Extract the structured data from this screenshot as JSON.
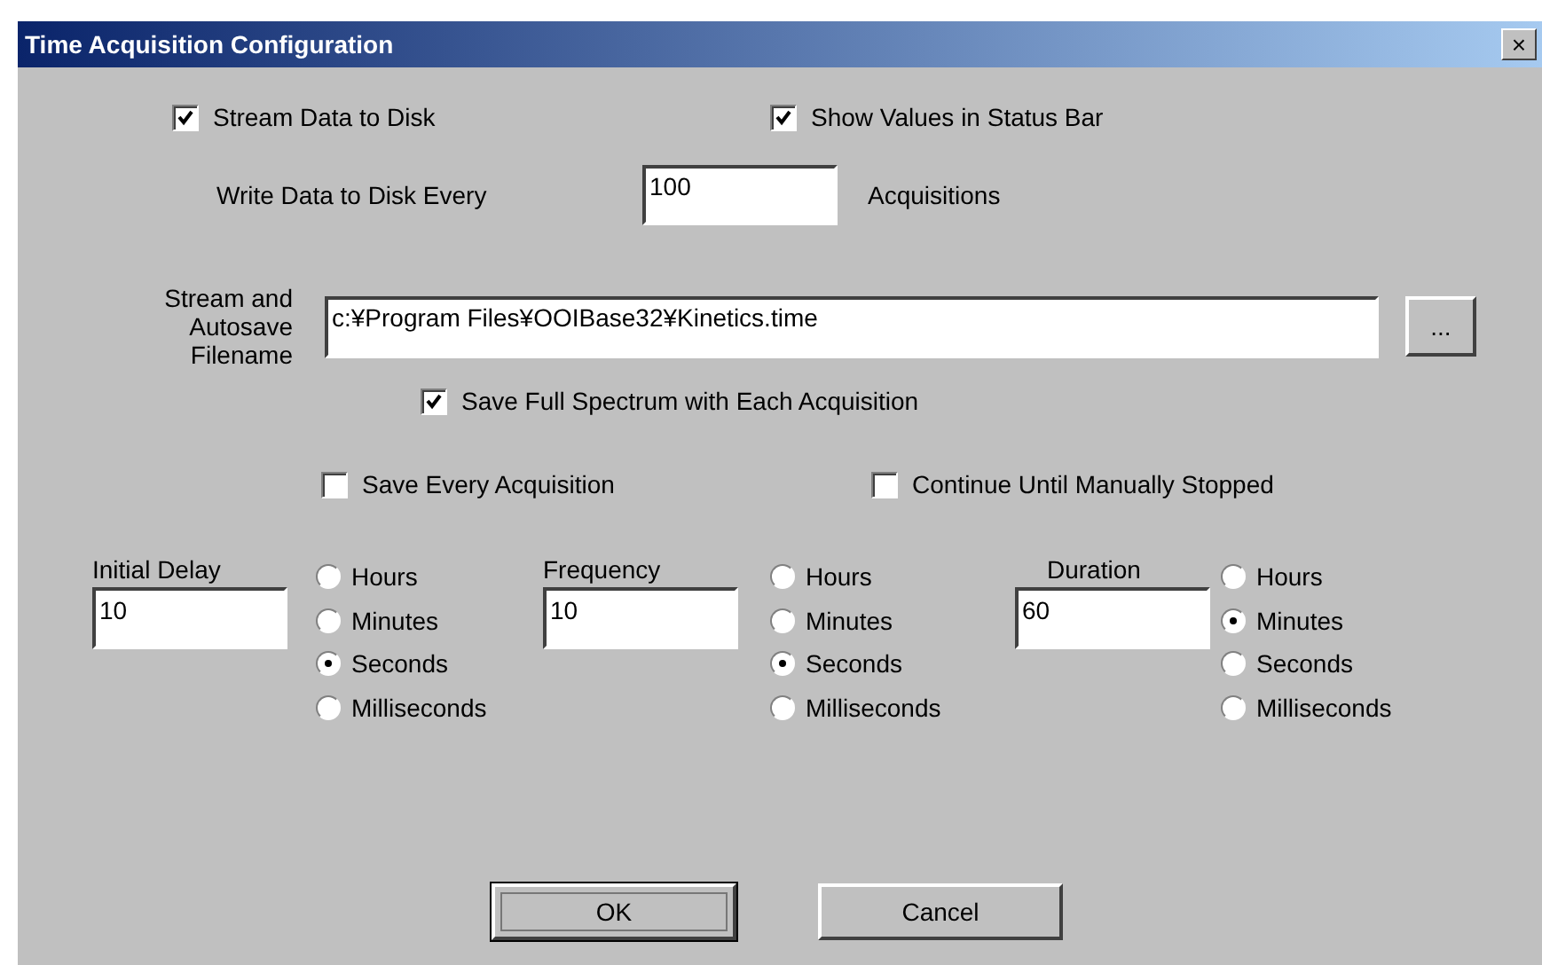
{
  "window": {
    "title": "Time Acquisition Configuration",
    "close": "×"
  },
  "top_options": [
    {
      "label": "Stream Data to Disk",
      "checked": true
    },
    {
      "label": "Show Values in Status Bar",
      "checked": true
    }
  ],
  "write_every": {
    "label": "Write Data to Disk Every",
    "value": "100",
    "unit": "Acquisitions"
  },
  "filename": {
    "label": "Stream and Autosave Filename",
    "value": "c:¥Program Files¥OOIBase32¥Kinetics.time",
    "browse": "..."
  },
  "save_full_spectrum": {
    "label": "Save Full Spectrum with Each Acquisition",
    "checked": true
  },
  "save_options": [
    {
      "label": "Save Every Acquisition",
      "checked": false
    },
    {
      "label": "Continue Until Manually Stopped",
      "checked": false
    }
  ],
  "timings": [
    {
      "label": "Initial Delay",
      "value": "10",
      "units": [
        {
          "label": "Hours",
          "selected": false
        },
        {
          "label": "Minutes",
          "selected": false
        },
        {
          "label": "Seconds",
          "selected": true
        },
        {
          "label": "Milliseconds",
          "selected": false
        }
      ]
    },
    {
      "label": "Frequency",
      "value": "10",
      "units": [
        {
          "label": "Hours",
          "selected": false
        },
        {
          "label": "Minutes",
          "selected": false
        },
        {
          "label": "Seconds",
          "selected": true
        },
        {
          "label": "Milliseconds",
          "selected": false
        }
      ]
    },
    {
      "label": "Duration",
      "value": "60",
      "units": [
        {
          "label": "Hours",
          "selected": false
        },
        {
          "label": "Minutes",
          "selected": true
        },
        {
          "label": "Seconds",
          "selected": false
        },
        {
          "label": "Milliseconds",
          "selected": false
        }
      ]
    }
  ],
  "buttons": [
    {
      "label": "OK",
      "default": true
    },
    {
      "label": "Cancel",
      "default": false
    }
  ]
}
